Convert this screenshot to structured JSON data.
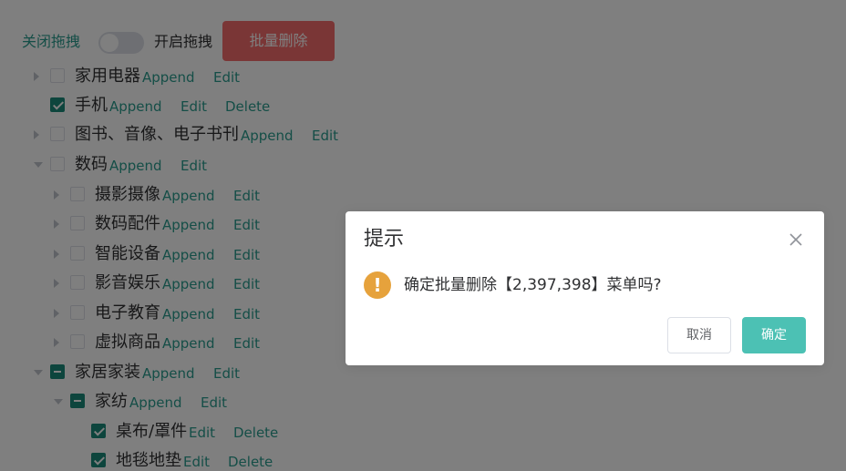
{
  "toolbar": {
    "drag_off_label": "关闭拖拽",
    "drag_on_label": "开启拖拽",
    "drag_enabled": false,
    "batch_delete_label": "批量删除"
  },
  "tree": {
    "nodes": [
      {
        "label": "家用电器",
        "caret": "right",
        "check": "unchecked",
        "actions": [
          "Append",
          "Edit"
        ]
      },
      {
        "label": "手机",
        "caret": "none",
        "check": "checked",
        "actions": [
          "Append",
          "Edit",
          "Delete"
        ]
      },
      {
        "label": "图书、音像、电子书刊",
        "caret": "right",
        "check": "unchecked",
        "actions": [
          "Append",
          "Edit"
        ]
      },
      {
        "label": "数码",
        "caret": "down",
        "check": "unchecked",
        "actions": [
          "Append",
          "Edit"
        ]
      },
      {
        "label": "摄影摄像",
        "caret": "right",
        "check": "unchecked",
        "actions": [
          "Append",
          "Edit"
        ]
      },
      {
        "label": "数码配件",
        "caret": "right",
        "check": "unchecked",
        "actions": [
          "Append",
          "Edit"
        ]
      },
      {
        "label": "智能设备",
        "caret": "right",
        "check": "unchecked",
        "actions": [
          "Append",
          "Edit"
        ]
      },
      {
        "label": "影音娱乐",
        "caret": "right",
        "check": "unchecked",
        "actions": [
          "Append",
          "Edit"
        ]
      },
      {
        "label": "电子教育",
        "caret": "right",
        "check": "unchecked",
        "actions": [
          "Append",
          "Edit"
        ]
      },
      {
        "label": "虚拟商品",
        "caret": "right",
        "check": "unchecked",
        "actions": [
          "Append",
          "Edit"
        ]
      },
      {
        "label": "家居家装",
        "caret": "down",
        "check": "indeterminate",
        "actions": [
          "Append",
          "Edit"
        ]
      },
      {
        "label": "家纺",
        "caret": "down",
        "check": "indeterminate",
        "actions": [
          "Append",
          "Edit"
        ]
      },
      {
        "label": "桌布/罩件",
        "caret": "none",
        "check": "checked",
        "actions": [
          "Edit",
          "Delete"
        ]
      },
      {
        "label": "地毯地垫",
        "caret": "none",
        "check": "checked",
        "actions": [
          "Edit",
          "Delete"
        ]
      }
    ]
  },
  "dialog": {
    "title": "提示",
    "close_icon": "close-icon",
    "warning_icon": "warning-icon",
    "warning_glyph": "!",
    "message": "确定批量删除【2,397,398】菜单吗?",
    "cancel_label": "取消",
    "confirm_label": "确定"
  },
  "colors": {
    "accent": "#2a9d8f",
    "checkbox_checked": "#1a8a7a",
    "danger": "#f56c6c",
    "warning": "#e6a23c",
    "confirm": "#4cc1b4"
  }
}
